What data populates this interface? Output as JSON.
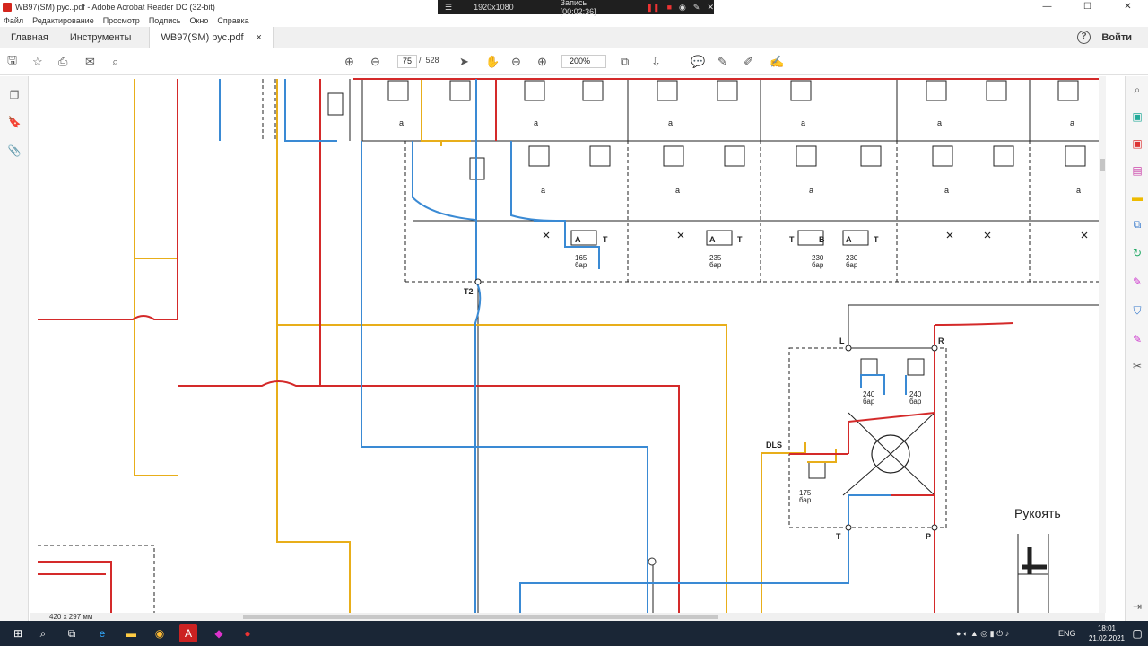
{
  "window": {
    "title": "WB97(SM) рус..pdf - Adobe Acrobat Reader DC (32-bit)"
  },
  "recorder": {
    "resolution": "1920x1080",
    "status": "Запись [00:02:36]"
  },
  "menu": [
    "Файл",
    "Редактирование",
    "Просмотр",
    "Подпись",
    "Окно",
    "Справка"
  ],
  "tabs": {
    "home": "Главная",
    "tools": "Инструменты",
    "document": "WB97(SM) рус.pdf",
    "close": "×"
  },
  "account": {
    "login": "Войти",
    "help": "?"
  },
  "toolbar": {
    "page_current": "75",
    "page_sep": "/",
    "page_total": "528",
    "zoom": "200%"
  },
  "statusbar": {
    "page_size": "420 x 297 мм"
  },
  "diagram": {
    "spool_mark": "a",
    "port_T": "T",
    "port_A": "A",
    "port_B": "B",
    "relief1": "165",
    "relief2": "235",
    "relief3": "230",
    "relief4": "230",
    "unit_bar": "бар",
    "t2": "T2",
    "port_L": "L",
    "port_R": "R",
    "port_DLS": "DLS",
    "port_P": "P",
    "relief_240": "240",
    "relief_175": "175",
    "label_arm": "Рукоять"
  },
  "taskbar": {
    "lang": "ENG",
    "time": "18:01",
    "date": "21.02.2021"
  },
  "colors": {
    "red": "#d42a2a",
    "blue": "#3a8ad4",
    "yellow": "#e8ae1a",
    "black": "#222222"
  }
}
